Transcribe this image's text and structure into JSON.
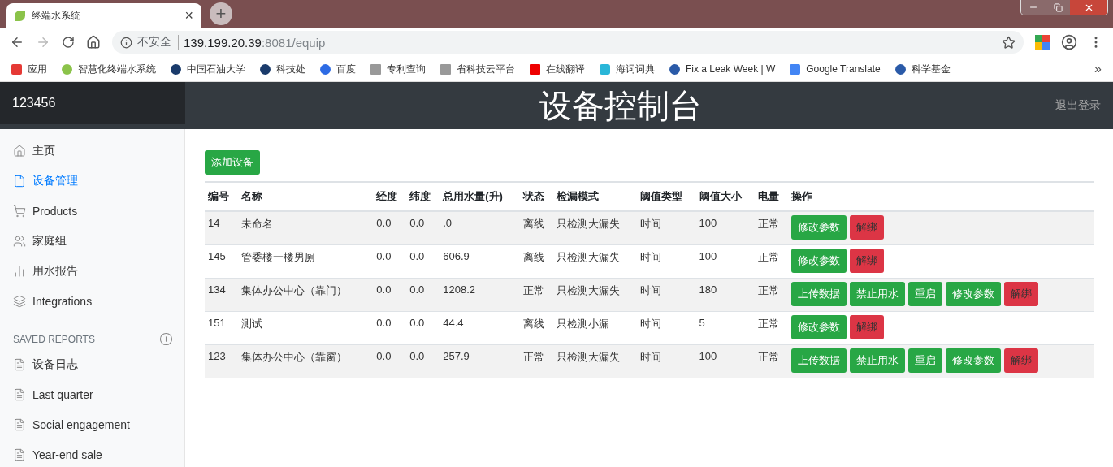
{
  "browser": {
    "tab": {
      "title": "终端水系统",
      "close": "×"
    },
    "new_tab": "+",
    "address": {
      "security": "不安全",
      "host": "139.199.20.39",
      "path": ":8081/equip"
    },
    "bookmarks": [
      {
        "label": "应用"
      },
      {
        "label": "智慧化终端水系统"
      },
      {
        "label": "中国石油大学"
      },
      {
        "label": "科技处"
      },
      {
        "label": "百度"
      },
      {
        "label": "专利查询"
      },
      {
        "label": "省科技云平台"
      },
      {
        "label": "在线翻译"
      },
      {
        "label": "海词词典"
      },
      {
        "label": "Fix a Leak Week | W"
      },
      {
        "label": "Google Translate"
      },
      {
        "label": "科学基金"
      }
    ],
    "more": "»"
  },
  "header": {
    "brand": "123456",
    "title": "设备控制台",
    "logout": "退出登录"
  },
  "sidebar": {
    "items": [
      {
        "label": "主页",
        "selected": false
      },
      {
        "label": "设备管理",
        "selected": true
      },
      {
        "label": "Products",
        "selected": false
      },
      {
        "label": "家庭组",
        "selected": false
      },
      {
        "label": "用水报告",
        "selected": false
      },
      {
        "label": "Integrations",
        "selected": false
      }
    ],
    "saved_reports": {
      "heading": "SAVED REPORTS",
      "items": [
        {
          "label": "设备日志"
        },
        {
          "label": "Last quarter"
        },
        {
          "label": "Social engagement"
        },
        {
          "label": "Year-end sale"
        }
      ]
    }
  },
  "add_button": "添加设备",
  "table": {
    "columns": [
      "编号",
      "名称",
      "经度",
      "纬度",
      "总用水量(升)",
      "状态",
      "检漏模式",
      "阈值类型",
      "阈值大小",
      "电量",
      "操作"
    ],
    "rows": [
      {
        "cells": [
          "14",
          "未命名",
          "0.0",
          "0.0",
          ".0",
          "离线",
          "只检测大漏失",
          "时间",
          "100",
          "正常"
        ],
        "actions": [
          {
            "label": "修改参数",
            "kind": "primary"
          },
          {
            "label": "解绑",
            "kind": "danger"
          }
        ]
      },
      {
        "cells": [
          "145",
          "管委楼一楼男厕",
          "0.0",
          "0.0",
          "606.9",
          "离线",
          "只检测大漏失",
          "时间",
          "100",
          "正常"
        ],
        "actions": [
          {
            "label": "修改参数",
            "kind": "primary"
          },
          {
            "label": "解绑",
            "kind": "danger"
          }
        ]
      },
      {
        "cells": [
          "134",
          "集体办公中心（靠门）",
          "0.0",
          "0.0",
          "1208.2",
          "正常",
          "只检测大漏失",
          "时间",
          "180",
          "正常"
        ],
        "actions": [
          {
            "label": "上传数据",
            "kind": "primary"
          },
          {
            "label": "禁止用水",
            "kind": "primary"
          },
          {
            "label": "重启",
            "kind": "primary"
          },
          {
            "label": "修改参数",
            "kind": "primary"
          },
          {
            "label": "解绑",
            "kind": "danger"
          }
        ]
      },
      {
        "cells": [
          "151",
          "测试",
          "0.0",
          "0.0",
          "44.4",
          "离线",
          "只检测小漏",
          "时间",
          "5",
          "正常"
        ],
        "actions": [
          {
            "label": "修改参数",
            "kind": "primary"
          },
          {
            "label": "解绑",
            "kind": "danger"
          }
        ]
      },
      {
        "cells": [
          "123",
          "集体办公中心（靠窗）",
          "0.0",
          "0.0",
          "257.9",
          "正常",
          "只检测大漏失",
          "时间",
          "100",
          "正常"
        ],
        "actions": [
          {
            "label": "上传数据",
            "kind": "primary"
          },
          {
            "label": "禁止用水",
            "kind": "primary"
          },
          {
            "label": "重启",
            "kind": "primary"
          },
          {
            "label": "修改参数",
            "kind": "primary"
          },
          {
            "label": "解绑",
            "kind": "danger"
          }
        ]
      }
    ]
  }
}
